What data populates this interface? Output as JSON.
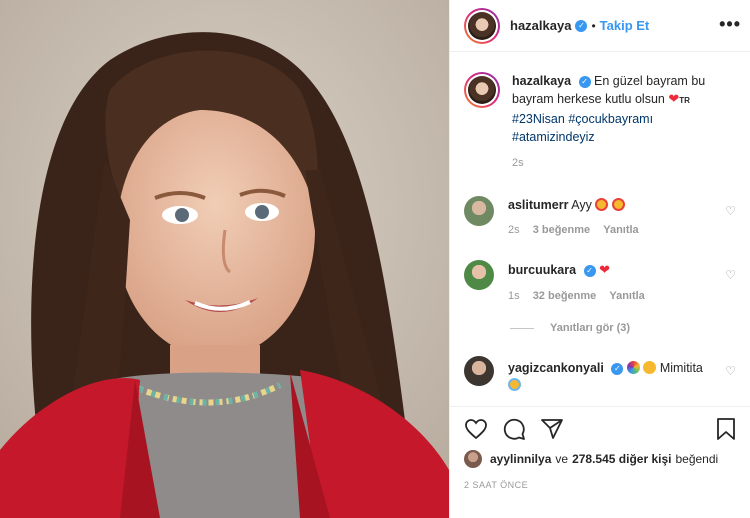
{
  "post": {
    "username": "hazalkaya",
    "follow_label": "Takip Et",
    "dot": "•",
    "more": "•••"
  },
  "caption": {
    "username": "hazalkaya",
    "text": "En güzel bayram bu bayram herkese kutlu olsun",
    "flag_code": "TR",
    "hashtags": [
      "#23Nisan",
      "#çocukbayramı",
      "#atamizindeyiz"
    ],
    "time": "2s"
  },
  "comments": [
    {
      "username": "aslitumerr",
      "text": "Ayy",
      "time": "2s",
      "likes": "3 beğenme",
      "reply": "Yanıtla"
    },
    {
      "username": "burcuukara",
      "text": "",
      "time": "1s",
      "likes": "32 beğenme",
      "reply": "Yanıtla"
    },
    {
      "username": "yagizcankonyali",
      "text": "Mimitita",
      "time": "",
      "likes": "",
      "reply": ""
    }
  ],
  "replies_toggle": "Yanıtları gör (3)",
  "likes": {
    "first_user": "ayylinnilya",
    "connector": "ve",
    "count_text": "278.545 diğer kişi",
    "suffix": "beğendi"
  },
  "posted_ago": "2 SAAT ÖNCE",
  "colors": {
    "accent": "#3897f0",
    "heart": "#ed2a3a",
    "hashtag": "#00376b"
  },
  "icons": [
    "heart-icon",
    "comment-icon",
    "share-icon",
    "bookmark-icon",
    "more-icon",
    "verified-icon"
  ]
}
